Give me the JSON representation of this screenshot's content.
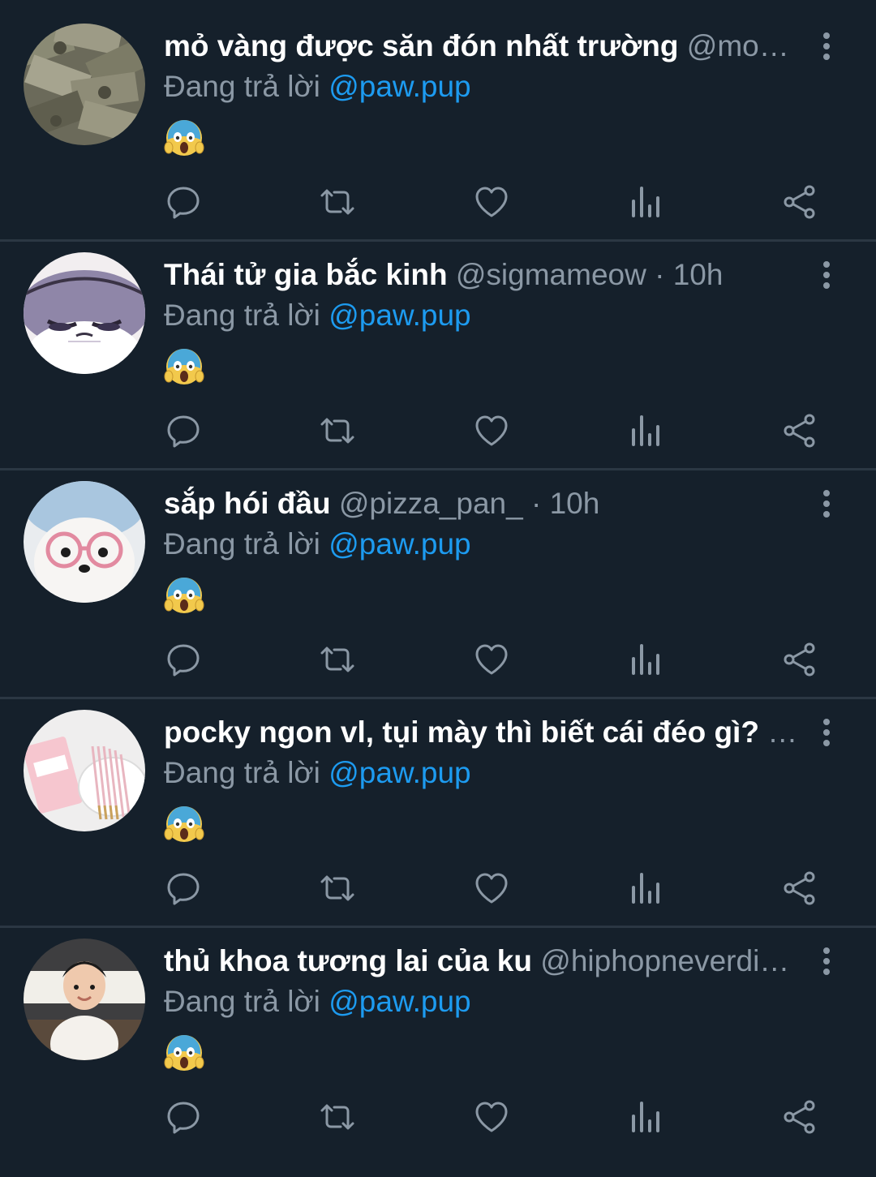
{
  "reply_prefix": "Đang trả lời",
  "colors": {
    "background": "#15202b",
    "divider": "#2b3743",
    "muted_text": "#8b98a5",
    "link": "#1d9bf0"
  },
  "icons": {
    "reply": "comment-bubble-icon",
    "retweet": "retweet-icon",
    "like": "heart-icon",
    "stats": "bar-chart-icon",
    "share": "share-icon",
    "more": "vertical-ellipsis-icon",
    "emoji": "face-screaming-in-fear-emoji"
  },
  "tweets": [
    {
      "display_name": "mỏ vàng được săn đón nhất trường",
      "handle": "@mo…",
      "dot": "",
      "time": "",
      "reply_to": "@paw.pup",
      "body": "😱",
      "avatar": "money-pile-avatar"
    },
    {
      "display_name": "Thái tử gia bắc kinh",
      "handle": "@sigmameow",
      "dot": "·",
      "time": "10h",
      "reply_to": "@paw.pup",
      "body": "😱",
      "avatar": "cartoon-cat-avatar"
    },
    {
      "display_name": "sắp hói đầu",
      "handle": "@pizza_pan_",
      "dot": "·",
      "time": "10h",
      "reply_to": "@paw.pup",
      "body": "😱",
      "avatar": "dog-with-glasses-avatar"
    },
    {
      "display_name": "pocky ngon vl, tụi mày thì biết cái đéo gì?",
      "handle": "…",
      "dot": "",
      "time": "",
      "reply_to": "@paw.pup",
      "body": "😱",
      "avatar": "pocky-sticks-avatar"
    },
    {
      "display_name": "thủ khoa tương lai của ku",
      "handle": "@hiphopneverdi…",
      "dot": "",
      "time": "",
      "reply_to": "@paw.pup",
      "body": "😱",
      "avatar": "baby-photo-avatar"
    }
  ]
}
